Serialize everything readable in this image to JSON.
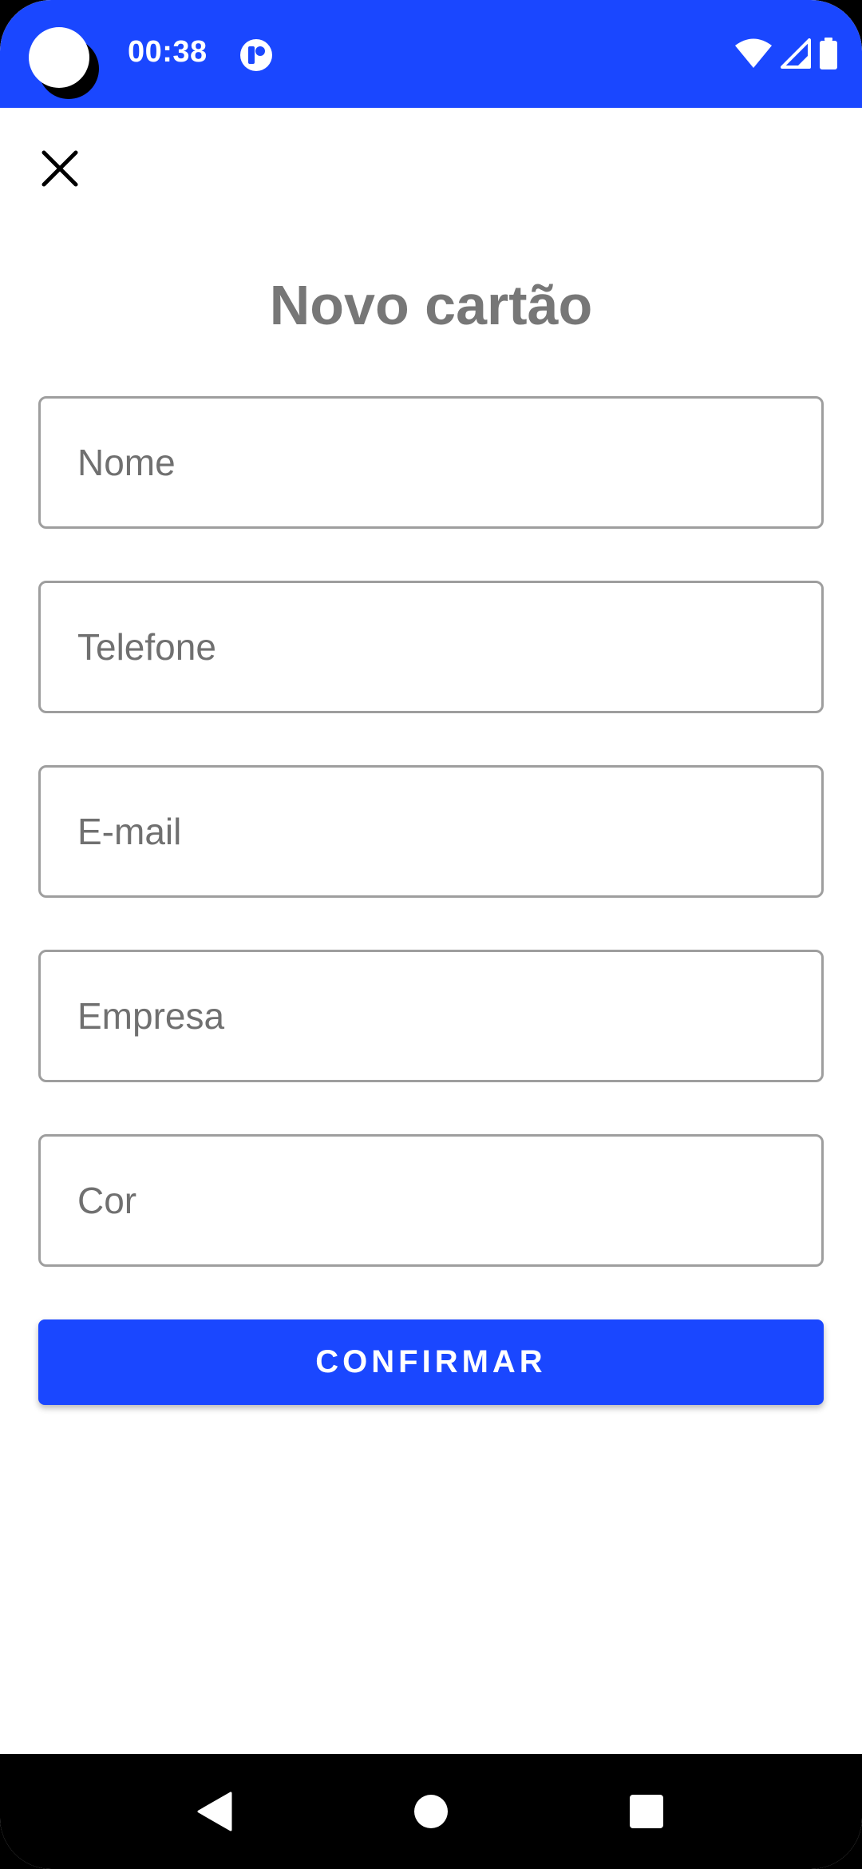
{
  "status_bar": {
    "time": "00:38",
    "background_color": "#1a47ff",
    "icons": [
      "camera-cutout",
      "app-notification-icon",
      "wifi-icon",
      "cell-signal-icon",
      "battery-icon"
    ]
  },
  "header": {
    "close_icon": "close-icon",
    "title": "Novo cartão"
  },
  "form": {
    "fields": [
      {
        "name": "nome",
        "placeholder": "Nome",
        "value": ""
      },
      {
        "name": "telefone",
        "placeholder": "Telefone",
        "value": ""
      },
      {
        "name": "email",
        "placeholder": "E-mail",
        "value": ""
      },
      {
        "name": "empresa",
        "placeholder": "Empresa",
        "value": ""
      },
      {
        "name": "cor",
        "placeholder": "Cor",
        "value": ""
      }
    ],
    "confirm_label": "CONFIRMAR",
    "accent_color": "#1a47ff"
  },
  "nav_bar": {
    "icons": [
      "back-icon",
      "home-icon",
      "recents-icon"
    ]
  }
}
